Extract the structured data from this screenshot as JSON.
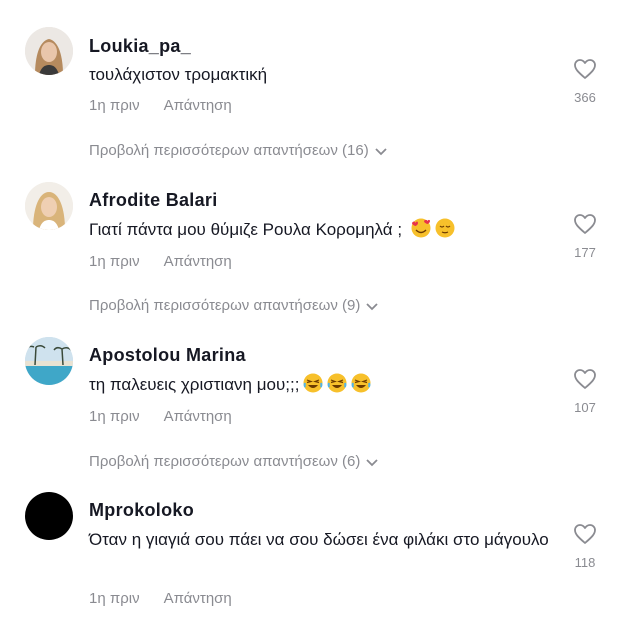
{
  "comments": [
    {
      "author": "Loukia_pa_",
      "text": "τουλάχιστον τρομακτική",
      "time": "1η πριν",
      "reply": "Απάντηση",
      "likes": "366",
      "more": "Προβολή περισσότερων απαντήσεων (16)"
    },
    {
      "author": "Afrodite Balari",
      "text": "Γιατί πάντα μου θύμιζε Ρουλα Κορομηλά ; ",
      "time": "1η πριν",
      "reply": "Απάντηση",
      "likes": "177",
      "more": "Προβολή περισσότερων απαντήσεων (9)"
    },
    {
      "author": "Apostolou Marina",
      "text": "τη παλευεις χριστιανη μου;;;",
      "time": "1η πριν",
      "reply": "Απάντηση",
      "likes": "107",
      "more": "Προβολή περισσότερων απαντήσεων (6)"
    },
    {
      "author": "Mprokoloko",
      "text": "Όταν η γιαγιά σου πάει να σου δώσει ένα φιλάκι στο μάγουλο",
      "time": "1η πριν",
      "reply": "Απάντηση",
      "likes": "118"
    }
  ],
  "icons": {
    "like": "heart-outline-icon",
    "more": "chevron-down-icon"
  },
  "colors": {
    "text": "#161823",
    "secondary": "#8a8b91",
    "emoji": "#f7c02b"
  }
}
